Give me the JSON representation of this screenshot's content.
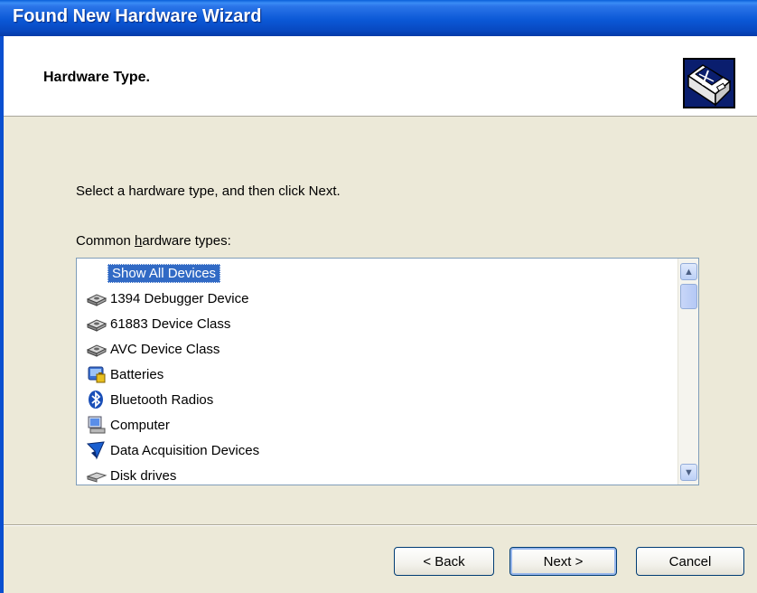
{
  "window": {
    "title": "Found New Hardware Wizard"
  },
  "header": {
    "title": "Hardware Type.",
    "icon": "hardware-install-icon"
  },
  "instruction": "Select a hardware type, and then click Next.",
  "list_label": "Common hardware types:",
  "list": {
    "items": [
      {
        "label": "Show All Devices",
        "icon": "none",
        "selected": true
      },
      {
        "label": "1394 Debugger Device",
        "icon": "device-class-icon"
      },
      {
        "label": "61883 Device Class",
        "icon": "device-class-icon"
      },
      {
        "label": "AVC Device Class",
        "icon": "device-class-icon"
      },
      {
        "label": "Batteries",
        "icon": "battery-icon"
      },
      {
        "label": "Bluetooth Radios",
        "icon": "bluetooth-icon"
      },
      {
        "label": "Computer",
        "icon": "computer-icon"
      },
      {
        "label": "Data Acquisition Devices",
        "icon": "data-acquisition-icon"
      },
      {
        "label": "Disk drives",
        "icon": "disk-drive-icon"
      }
    ]
  },
  "buttons": {
    "back": "< Back",
    "next": "Next >",
    "cancel": "Cancel"
  },
  "colors": {
    "titlebar": "#0a5fd8",
    "selection": "#316ac5",
    "dialog": "#ece9d8"
  }
}
